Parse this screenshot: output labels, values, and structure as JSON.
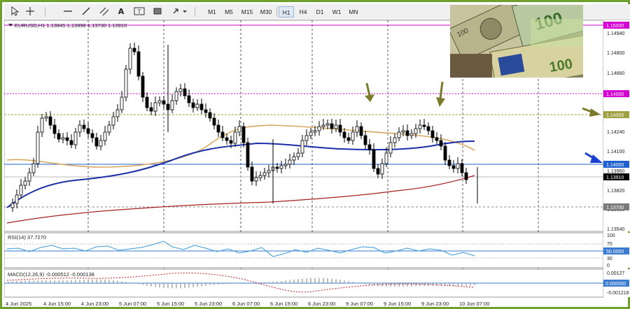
{
  "toolbar": {
    "tools": [
      {
        "name": "cursor-icon"
      },
      {
        "name": "crosshair-icon"
      },
      {
        "name": "horizontal-line-icon"
      },
      {
        "name": "trendline-icon"
      },
      {
        "name": "equidistant-channel-icon"
      },
      {
        "name": "text-icon"
      },
      {
        "name": "text-label-icon"
      },
      {
        "name": "shapes-icon"
      },
      {
        "name": "arrows-icon"
      }
    ],
    "timeframes": [
      "M1",
      "M5",
      "M15",
      "M30",
      "H1",
      "H4",
      "D1",
      "W1",
      "MN"
    ],
    "active_timeframe": "H1"
  },
  "chart": {
    "header": "EURUSD,H1  1.13945 1.13998 1.13730 1.13910",
    "price_ticks": [
      "1.14940",
      "1.14800",
      "1.14660",
      "1.14240",
      "1.14100",
      "1.13960",
      "1.13820",
      "1.13680",
      "1.13540"
    ],
    "price_markers": [
      {
        "label": "1.15000",
        "color": "#d400d4"
      },
      {
        "label": "1.14500",
        "color": "#d400d4"
      },
      {
        "label": "1.14350",
        "color": "#a0a040"
      },
      {
        "label": "1.14000",
        "color": "#2060d0"
      },
      {
        "label": "1.13910",
        "color": "#000000"
      },
      {
        "label": "1.13700",
        "color": "#7a7a7a"
      }
    ],
    "time_labels": [
      "4 Jun 2025",
      "4 Jun 15:00",
      "4 Jun 23:00",
      "5 Jun 07:00",
      "5 Jun 15:00",
      "5 Jun 23:00",
      "6 Jun 07:00",
      "6 Jun 15:00",
      "6 Jun 23:00",
      "9 Jun 07:00",
      "9 Jun 15:00",
      "9 Jun 23:00",
      "10 Jun 07:00"
    ],
    "rsi": {
      "label": "RSI(14) 37.7270",
      "ticks": [
        "100",
        "70",
        "50.0000",
        "30",
        "0"
      ]
    },
    "macd": {
      "label": "MACD(12,26,9) -0.000512 -0.000138",
      "ticks": [
        "0.00127",
        "0.000000",
        "-0.001218"
      ]
    },
    "colors": {
      "bull": "#ffffff",
      "bear": "#000000",
      "ma_fast": "#1a2fa8",
      "ma_mid": "#d8a860",
      "ma_slow": "#a82020",
      "arrow_olive": "#7a7a2a",
      "arrow_blue": "#1a3fd0",
      "border": "#6fa02e"
    }
  }
}
